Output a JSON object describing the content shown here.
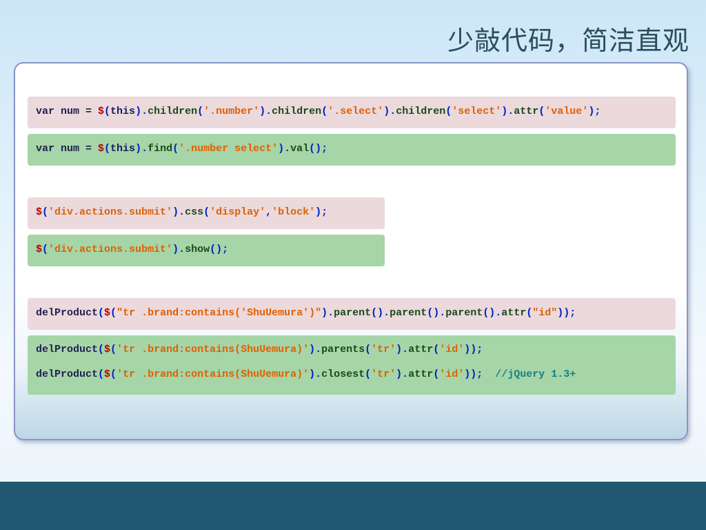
{
  "slide": {
    "title": "少敲代码，简洁直观"
  },
  "code_blocks": [
    {
      "style": "pink",
      "lines": [
        [
          {
            "c": "k",
            "t": "var num = "
          },
          {
            "c": "d",
            "t": "$"
          },
          {
            "c": "p",
            "t": "("
          },
          {
            "c": "t",
            "t": "this"
          },
          {
            "c": "p",
            "t": ")."
          },
          {
            "c": "m",
            "t": "children"
          },
          {
            "c": "p",
            "t": "("
          },
          {
            "c": "s",
            "t": "'.number'"
          },
          {
            "c": "p",
            "t": ")."
          },
          {
            "c": "m",
            "t": "children"
          },
          {
            "c": "p",
            "t": "("
          },
          {
            "c": "s",
            "t": "'.select'"
          },
          {
            "c": "p",
            "t": ")."
          },
          {
            "c": "m",
            "t": "children"
          },
          {
            "c": "p",
            "t": "("
          },
          {
            "c": "s",
            "t": "'select'"
          },
          {
            "c": "p",
            "t": ")."
          },
          {
            "c": "m",
            "t": "attr"
          },
          {
            "c": "p",
            "t": "("
          },
          {
            "c": "s",
            "t": "'value'"
          },
          {
            "c": "p",
            "t": ");"
          }
        ]
      ]
    },
    {
      "style": "green",
      "lines": [
        [
          {
            "c": "k",
            "t": "var num = "
          },
          {
            "c": "d",
            "t": "$"
          },
          {
            "c": "p",
            "t": "("
          },
          {
            "c": "t",
            "t": "this"
          },
          {
            "c": "p",
            "t": ")."
          },
          {
            "c": "m",
            "t": "find"
          },
          {
            "c": "p",
            "t": "("
          },
          {
            "c": "s",
            "t": "'.number select'"
          },
          {
            "c": "p",
            "t": ")."
          },
          {
            "c": "m",
            "t": "val"
          },
          {
            "c": "p",
            "t": "();"
          }
        ]
      ]
    },
    {
      "style": "pink",
      "lines": [
        [
          {
            "c": "d",
            "t": "$"
          },
          {
            "c": "p",
            "t": "("
          },
          {
            "c": "s",
            "t": "'div.actions.submit'"
          },
          {
            "c": "p",
            "t": ")."
          },
          {
            "c": "m",
            "t": "css"
          },
          {
            "c": "p",
            "t": "("
          },
          {
            "c": "s",
            "t": "'display'"
          },
          {
            "c": "p",
            "t": ","
          },
          {
            "c": "s",
            "t": "'block'"
          },
          {
            "c": "p",
            "t": ");"
          }
        ]
      ]
    },
    {
      "style": "green",
      "lines": [
        [
          {
            "c": "d",
            "t": "$"
          },
          {
            "c": "p",
            "t": "("
          },
          {
            "c": "s",
            "t": "'div.actions.submit'"
          },
          {
            "c": "p",
            "t": ")."
          },
          {
            "c": "m",
            "t": "show"
          },
          {
            "c": "p",
            "t": "();"
          }
        ]
      ]
    },
    {
      "style": "pink",
      "lines": [
        [
          {
            "c": "k",
            "t": "delProduct"
          },
          {
            "c": "p",
            "t": "("
          },
          {
            "c": "d",
            "t": "$"
          },
          {
            "c": "p",
            "t": "("
          },
          {
            "c": "s",
            "t": "\"tr .brand:contains('ShuUemura')\""
          },
          {
            "c": "p",
            "t": ")."
          },
          {
            "c": "m",
            "t": "parent"
          },
          {
            "c": "p",
            "t": "()."
          },
          {
            "c": "m",
            "t": "parent"
          },
          {
            "c": "p",
            "t": "()."
          },
          {
            "c": "m",
            "t": "parent"
          },
          {
            "c": "p",
            "t": "()."
          },
          {
            "c": "m",
            "t": "attr"
          },
          {
            "c": "p",
            "t": "("
          },
          {
            "c": "s",
            "t": "\"id\""
          },
          {
            "c": "p",
            "t": "));"
          }
        ]
      ]
    },
    {
      "style": "green",
      "lines": [
        [
          {
            "c": "k",
            "t": "delProduct"
          },
          {
            "c": "p",
            "t": "("
          },
          {
            "c": "d",
            "t": "$"
          },
          {
            "c": "p",
            "t": "("
          },
          {
            "c": "s",
            "t": "'tr .brand:contains(ShuUemura)'"
          },
          {
            "c": "p",
            "t": ")."
          },
          {
            "c": "m",
            "t": "parents"
          },
          {
            "c": "p",
            "t": "("
          },
          {
            "c": "s",
            "t": "'tr'"
          },
          {
            "c": "p",
            "t": ")."
          },
          {
            "c": "m",
            "t": "attr"
          },
          {
            "c": "p",
            "t": "("
          },
          {
            "c": "s",
            "t": "'id'"
          },
          {
            "c": "p",
            "t": "));"
          }
        ],
        [
          {
            "c": "k",
            "t": "delProduct"
          },
          {
            "c": "p",
            "t": "("
          },
          {
            "c": "d",
            "t": "$"
          },
          {
            "c": "p",
            "t": "("
          },
          {
            "c": "s",
            "t": "'tr .brand:contains(ShuUemura)'"
          },
          {
            "c": "p",
            "t": ")."
          },
          {
            "c": "m",
            "t": "closest"
          },
          {
            "c": "p",
            "t": "("
          },
          {
            "c": "s",
            "t": "'tr'"
          },
          {
            "c": "p",
            "t": ")."
          },
          {
            "c": "m",
            "t": "attr"
          },
          {
            "c": "p",
            "t": "("
          },
          {
            "c": "s",
            "t": "'id'"
          },
          {
            "c": "p",
            "t": "));"
          },
          {
            "c": "k",
            "t": "  "
          },
          {
            "c": "c",
            "t": "//jQuery 1.3+"
          }
        ]
      ]
    }
  ],
  "colors": {
    "background_top": "#cbe6f6",
    "panel_border": "#8a94c6",
    "pink_box": "#ebd9dc",
    "green_box": "#a6d5a7",
    "footer_bar": "#235873",
    "title_text": "#2b4d5e"
  }
}
